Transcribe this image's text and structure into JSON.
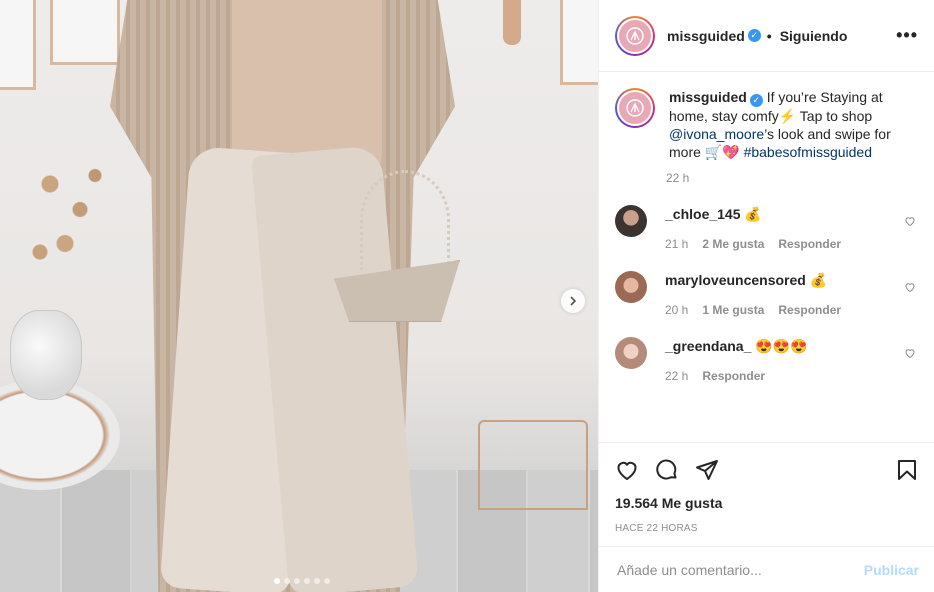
{
  "post": {
    "author": "missguided",
    "follow_status": "Siguiendo",
    "separator": "•",
    "verified_mark": "✓",
    "caption": {
      "text_1": "If you’re Staying at home, stay comfy",
      "emoji_1": "⚡",
      "text_2": "Tap to shop",
      "mention": "@ivona_moore",
      "text_3": "’s look and swipe for more",
      "emoji_2": "🛒💖",
      "hashtag": "#babesofmissguided"
    },
    "caption_time": "22 h",
    "likes": "19.564 Me gusta",
    "posted_ago": "HACE 22 HORAS"
  },
  "comments": [
    {
      "user": "_chloe_145",
      "text": "💰",
      "time": "21 h",
      "likes": "2 Me gusta",
      "reply": "Responder",
      "avatar_color": "#3b3430"
    },
    {
      "user": "maryloveuncensored",
      "text": "💰",
      "time": "20 h",
      "likes": "1 Me gusta",
      "reply": "Responder",
      "avatar_color": "#9a6a55"
    },
    {
      "user": "_greendana_",
      "text": "😍😍😍",
      "time": "22 h",
      "likes": "",
      "reply": "Responder",
      "avatar_color": "#b48a7a"
    }
  ],
  "comment_box": {
    "placeholder": "Añade un comentario...",
    "publish": "Publicar"
  },
  "colors": {
    "brand_avatar": "#e8a9b6",
    "link": "#00376b",
    "publish_disabled": "#b3dbff",
    "verified": "#3897f0"
  },
  "carousel": {
    "total": 6,
    "active": 1
  }
}
